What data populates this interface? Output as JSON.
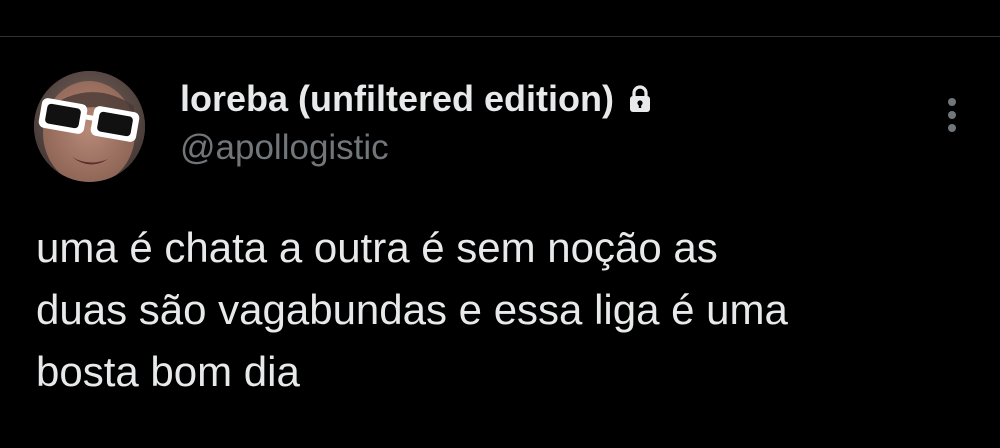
{
  "post": {
    "author": {
      "display_name": "loreba (unfiltered edition)",
      "handle": "@apollogistic",
      "protected_icon": "lock-icon",
      "avatar": "avatar-photo-sunglasses"
    },
    "menu_icon": "more-vertical-icon",
    "text": "uma é chata a outra é sem noção as\nduas são vagabundas e essa liga é uma\nbosta bom dia"
  },
  "colors": {
    "background": "#000000",
    "text_primary": "#e7e9ea",
    "text_secondary": "#71767b",
    "divider": "#2f3336"
  }
}
